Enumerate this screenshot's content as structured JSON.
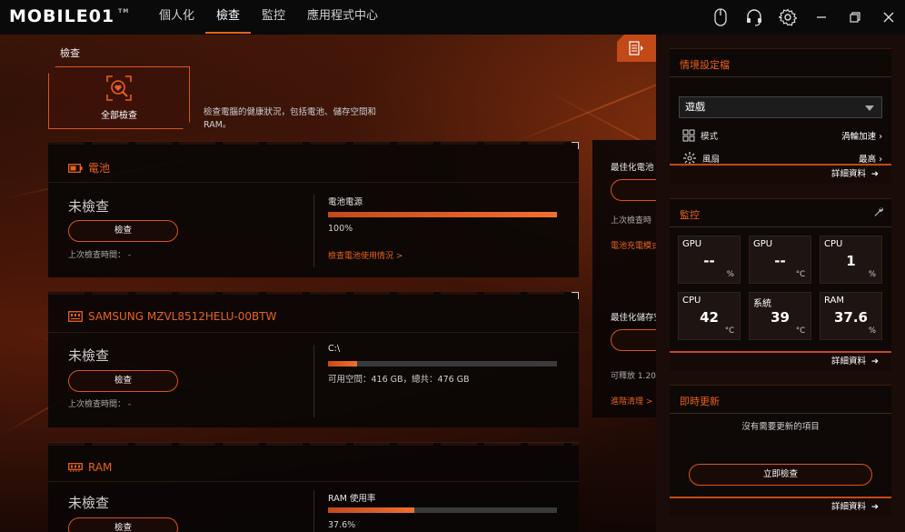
{
  "app": {
    "logo_text": "MOBILE01",
    "logo_tm": "TM"
  },
  "nav": {
    "tabs": [
      {
        "label": "個人化",
        "active": false
      },
      {
        "label": "檢查",
        "active": true
      },
      {
        "label": "監控",
        "active": false
      },
      {
        "label": "應用程式中心",
        "active": false
      }
    ]
  },
  "window_icons": [
    "mouse-icon",
    "headset-icon",
    "settings-gear-icon",
    "minimize-icon",
    "restore-icon",
    "close-icon"
  ],
  "colors": {
    "accent": "#e8621e",
    "bar_track": "#3a3a3a"
  },
  "checkup": {
    "page_title": "檢查",
    "scan_all_label": "全部檢查",
    "scan_all_desc": "檢查電腦的健康狀況，包括電池、儲存空間和 RAM。"
  },
  "battery": {
    "title": "電池",
    "status": "未檢查",
    "button": "檢查",
    "last_check": "上次檢查時間： -",
    "metric_label": "電池電源",
    "metric_value": "100%",
    "percent": 100,
    "link": "檢查電池使用情況 >"
  },
  "storage": {
    "title": "SAMSUNG MZVL8512HELU-00BTW",
    "status": "未檢查",
    "button": "檢查",
    "last_check": "上次檢查時間： -",
    "metric_label": "C:\\",
    "metric_value": "可用空間：416 GB，總共：476 GB",
    "percent": 12.6
  },
  "ram": {
    "title": "RAM",
    "status": "未檢查",
    "button": "檢查",
    "metric_label": "RAM 使用率",
    "metric_value": "37.6%",
    "percent": 37.6
  },
  "peek": {
    "battery_opt": "最佳化電池",
    "battery_last": "上次檢查時",
    "battery_link": "電池充電模式",
    "storage_opt": "最佳化儲存空",
    "storage_free": "可釋放 1.20",
    "storage_link": "進階清理 >"
  },
  "profile": {
    "title": "情境設定檔",
    "selected": "遊戲",
    "mode_label": "模式",
    "mode_value": "渦輪加速",
    "fan_label": "風扇",
    "fan_value": "最高",
    "details": "詳細資料"
  },
  "monitor": {
    "title": "監控",
    "details": "詳細資料",
    "tiles": [
      {
        "label": "GPU",
        "value": "--",
        "unit": "%"
      },
      {
        "label": "GPU",
        "value": "--",
        "unit": "°C"
      },
      {
        "label": "CPU",
        "value": "1",
        "unit": "%"
      },
      {
        "label": "CPU",
        "value": "42",
        "unit": "°C"
      },
      {
        "label": "系統",
        "value": "39",
        "unit": "°C"
      },
      {
        "label": "RAM",
        "value": "37.6",
        "unit": "%"
      }
    ]
  },
  "updates": {
    "title": "即時更新",
    "message": "沒有需要更新的項目",
    "button": "立即檢查",
    "details": "詳細資料"
  }
}
